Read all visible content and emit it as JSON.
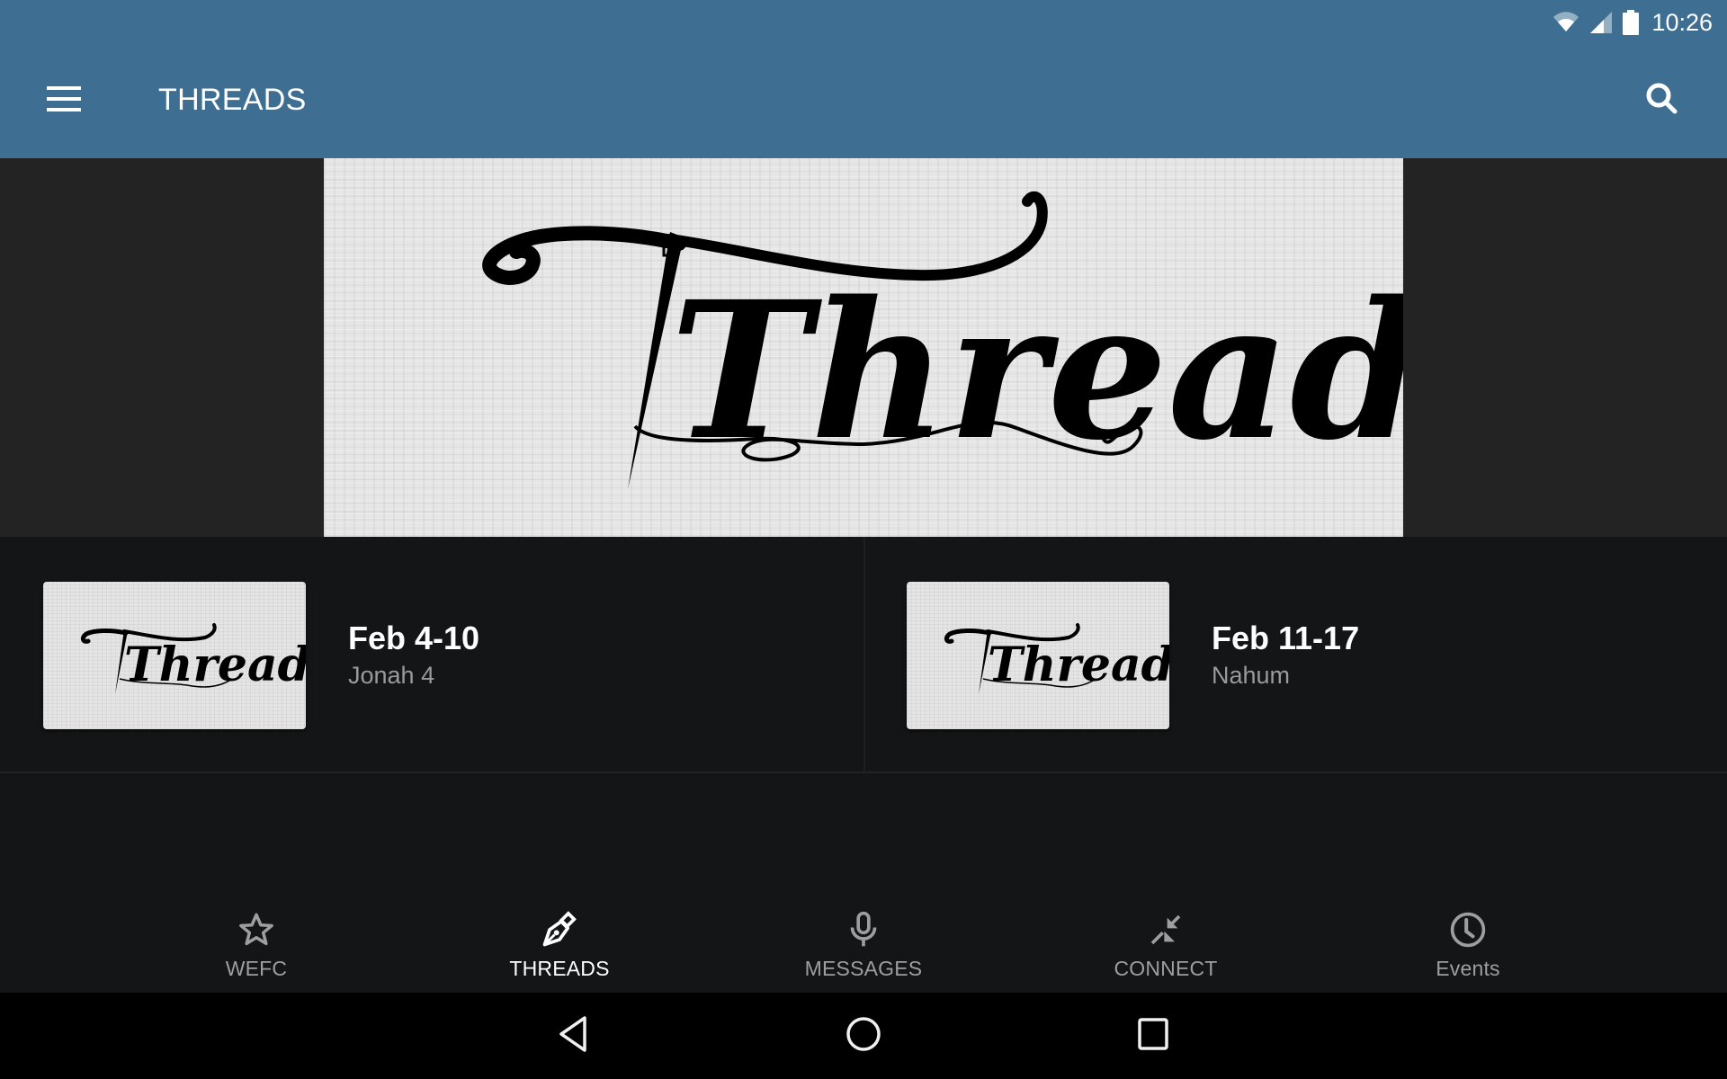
{
  "status_bar": {
    "time": "10:26",
    "icons": [
      "wifi-icon",
      "cell-signal-icon",
      "battery-icon"
    ]
  },
  "app_bar": {
    "title": "THREADS",
    "menu_icon": "hamburger-menu-icon",
    "search_icon": "search-icon",
    "background_color": "#3e6f93"
  },
  "hero": {
    "logo_text": "Threads"
  },
  "list": {
    "items": [
      {
        "title": "Feb 4-10",
        "subtitle": "Jonah 4",
        "thumbnail_text": "Threads"
      },
      {
        "title": "Feb 11-17",
        "subtitle": "Nahum",
        "thumbnail_text": "Threads"
      }
    ]
  },
  "bottom_nav": {
    "items": [
      {
        "label": "WEFC",
        "icon": "star-icon",
        "active": false
      },
      {
        "label": "THREADS",
        "icon": "pen-nib-icon",
        "active": true
      },
      {
        "label": "MESSAGES",
        "icon": "microphone-icon",
        "active": false
      },
      {
        "label": "CONNECT",
        "icon": "connect-arrows-icon",
        "active": false
      },
      {
        "label": "Events",
        "icon": "clock-icon",
        "active": false
      }
    ]
  },
  "system_nav": {
    "buttons": [
      "back",
      "home",
      "recents"
    ]
  }
}
